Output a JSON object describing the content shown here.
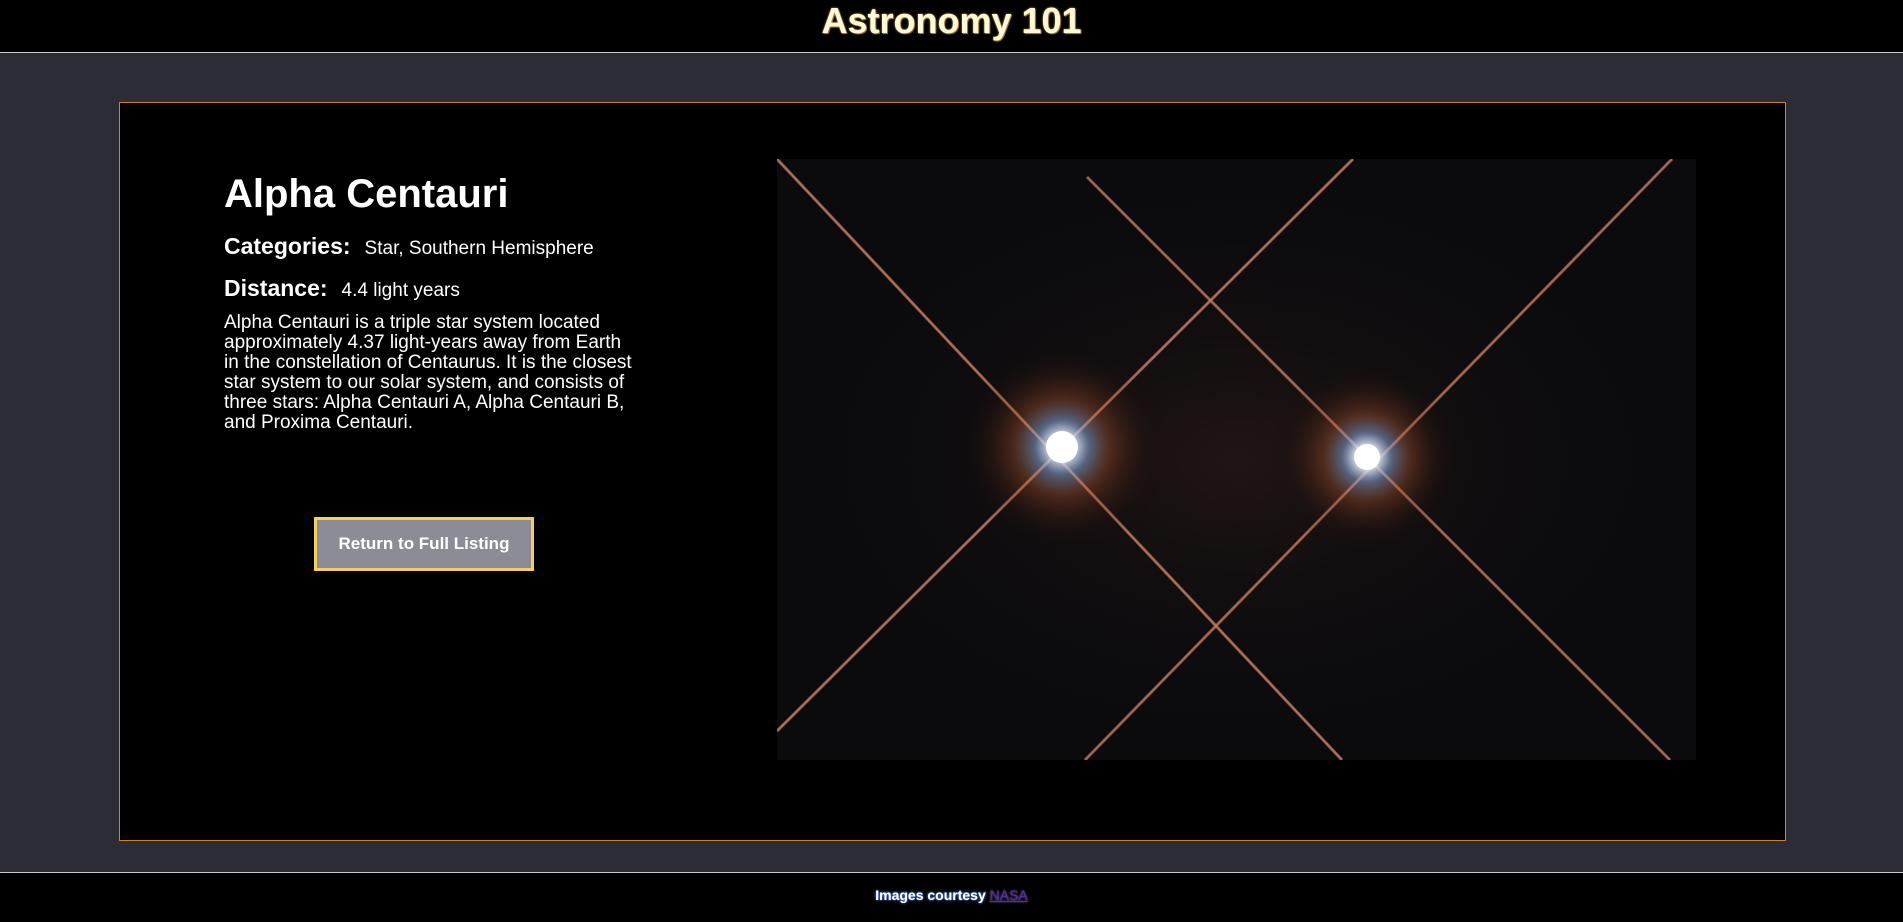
{
  "header": {
    "title": "Astronomy 101"
  },
  "object": {
    "name": "Alpha Centauri",
    "categories_label": "Categories:",
    "categories_value": "Star, Southern Hemisphere",
    "distance_label": "Distance:",
    "distance_value": "4.4 light years",
    "description": "Alpha Centauri is a triple star system located approximately 4.37 light-years away from Earth in the constellation of Centaurus. It is the closest star system to our solar system, and consists of three stars: Alpha Centauri A, Alpha Centauri B, and Proxima Centauri.",
    "return_button_label": "Return to Full Listing"
  },
  "footer": {
    "credit_text": "Images courtesy",
    "credit_link": "NASA"
  },
  "colors": {
    "page_background": "#2c2c35",
    "card_border": "#d0822e",
    "button_background": "#8b8c95",
    "button_border": "#f3cf62",
    "link": "#5a2d9c"
  }
}
